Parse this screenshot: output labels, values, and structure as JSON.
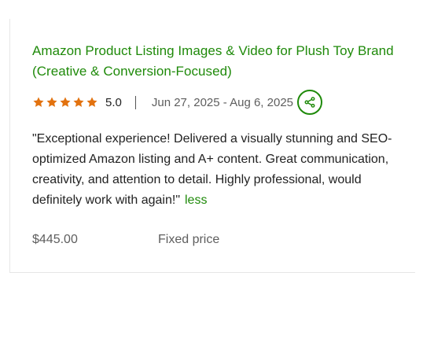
{
  "review_card": {
    "title": "Amazon Product Listing Images & Video for Plush Toy Brand (Creative & Conversion-Focused)",
    "rating": {
      "stars": 5,
      "max_stars": 5,
      "score_text": "5.0",
      "star_color": "#e2720f"
    },
    "dates": "Jun 27, 2025 - Aug 6, 2025",
    "share_icon": "share-icon",
    "review_text": "\"Exceptional experience! Delivered a visually stunning and SEO-optimized Amazon listing and A+ content. Great communication, creativity, and attention to detail. Highly professional, would definitely work with again!\"",
    "less_label": "less",
    "price": "$445.00",
    "price_type": "Fixed price",
    "accent_color": "#1f8a0a"
  }
}
